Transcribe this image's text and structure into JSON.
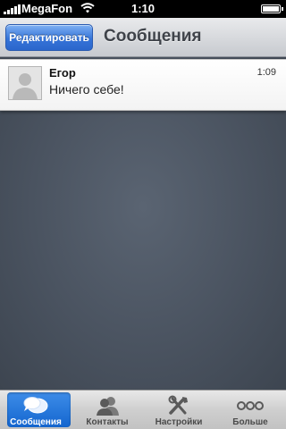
{
  "status_bar": {
    "carrier": "MegaFon",
    "time": "1:10",
    "battery_level": 1.0
  },
  "navbar": {
    "edit_label": "Редактировать",
    "title": "Сообщения"
  },
  "messages": [
    {
      "sender": "Егор",
      "time": "1:09",
      "preview": "Ничего себе!"
    }
  ],
  "tabbar": {
    "selected": "messages",
    "tabs": [
      {
        "label": "Сообщения",
        "icon": "speech-bubbles-icon"
      },
      {
        "label": "Контакты",
        "icon": "contacts-icon"
      },
      {
        "label": "Настройки",
        "icon": "tools-icon"
      },
      {
        "label": "Больше",
        "icon": "more-dots-icon"
      }
    ]
  },
  "colors": {
    "accent": "#2b66cc",
    "selected_tab": "#1466cf",
    "background": "#4a5360"
  }
}
